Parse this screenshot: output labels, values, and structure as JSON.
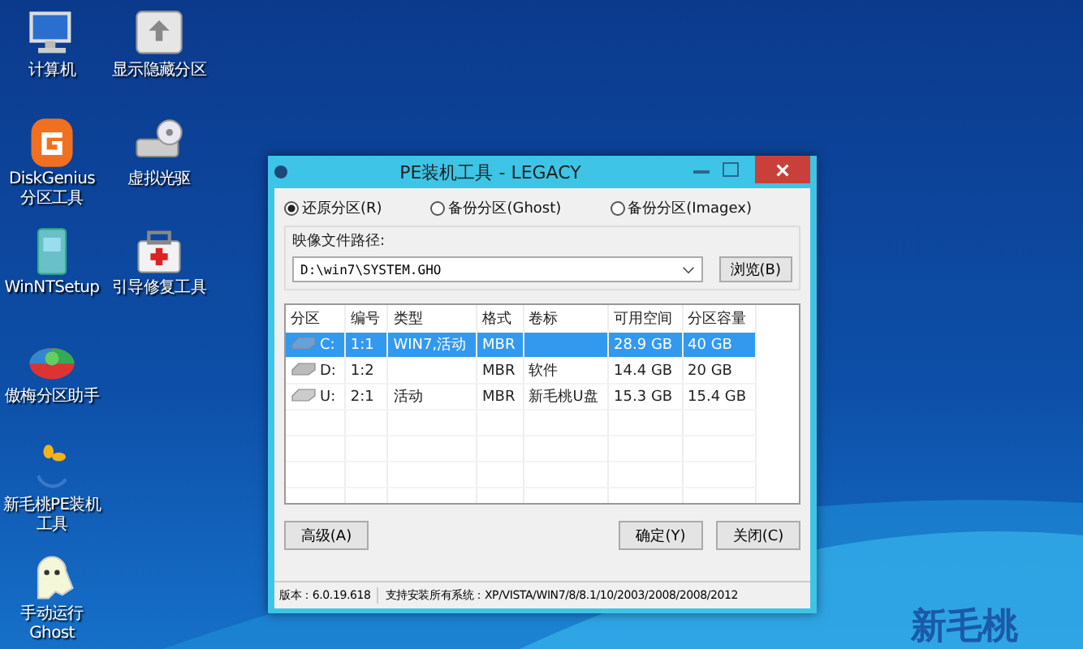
{
  "desktop_icons": [
    {
      "label": "计算机",
      "kind": "computer"
    },
    {
      "label": "显示隐藏分区",
      "kind": "partition"
    },
    {
      "label": "DiskGenius 分区工具",
      "kind": "diskgenius"
    },
    {
      "label": "虚拟光驱",
      "kind": "cdrom"
    },
    {
      "label": "WinNTSetup",
      "kind": "setup"
    },
    {
      "label": "引导修复工具",
      "kind": "repair"
    },
    {
      "label": "傲梅分区助手",
      "kind": "pie"
    },
    {
      "label": "新毛桃PE装机工具",
      "kind": "peach"
    },
    {
      "label": "手动运行 Ghost",
      "kind": "ghost"
    }
  ],
  "window": {
    "title": "PE装机工具 - LEGACY",
    "modes": [
      {
        "label": "还原分区(R)",
        "selected": true
      },
      {
        "label": "备份分区(Ghost)",
        "selected": false
      },
      {
        "label": "备份分区(Imagex)",
        "selected": false
      }
    ],
    "image_path": {
      "label": "映像文件路径:",
      "value": "D:\\win7\\SYSTEM.GHO",
      "browse_button": "浏览(B)"
    },
    "table": {
      "columns": [
        "分区",
        "编号",
        "类型",
        "格式",
        "卷标",
        "可用空间",
        "分区容量"
      ],
      "rows": [
        {
          "cells": [
            "C:",
            "1:1",
            "WIN7,活动",
            "MBR",
            "",
            "28.9 GB",
            "40 GB"
          ],
          "selected": true
        },
        {
          "cells": [
            "D:",
            "1:2",
            "",
            "MBR",
            "软件",
            "14.4 GB",
            "20 GB"
          ],
          "selected": false
        },
        {
          "cells": [
            "U:",
            "2:1",
            "活动",
            "MBR",
            "新毛桃U盘",
            "15.3 GB",
            "15.4 GB"
          ],
          "selected": false
        }
      ]
    },
    "buttons": {
      "advanced": "高级(A)",
      "ok": "确定(Y)",
      "close": "关闭(C)"
    },
    "status_bar": {
      "version": "版本：6.0.19.618",
      "systems": "支持安装所有系统：XP/VISTA/WIN7/8/8.1/10/2003/2008/2008/2012"
    }
  },
  "wallpaper_logo": "新毛桃"
}
